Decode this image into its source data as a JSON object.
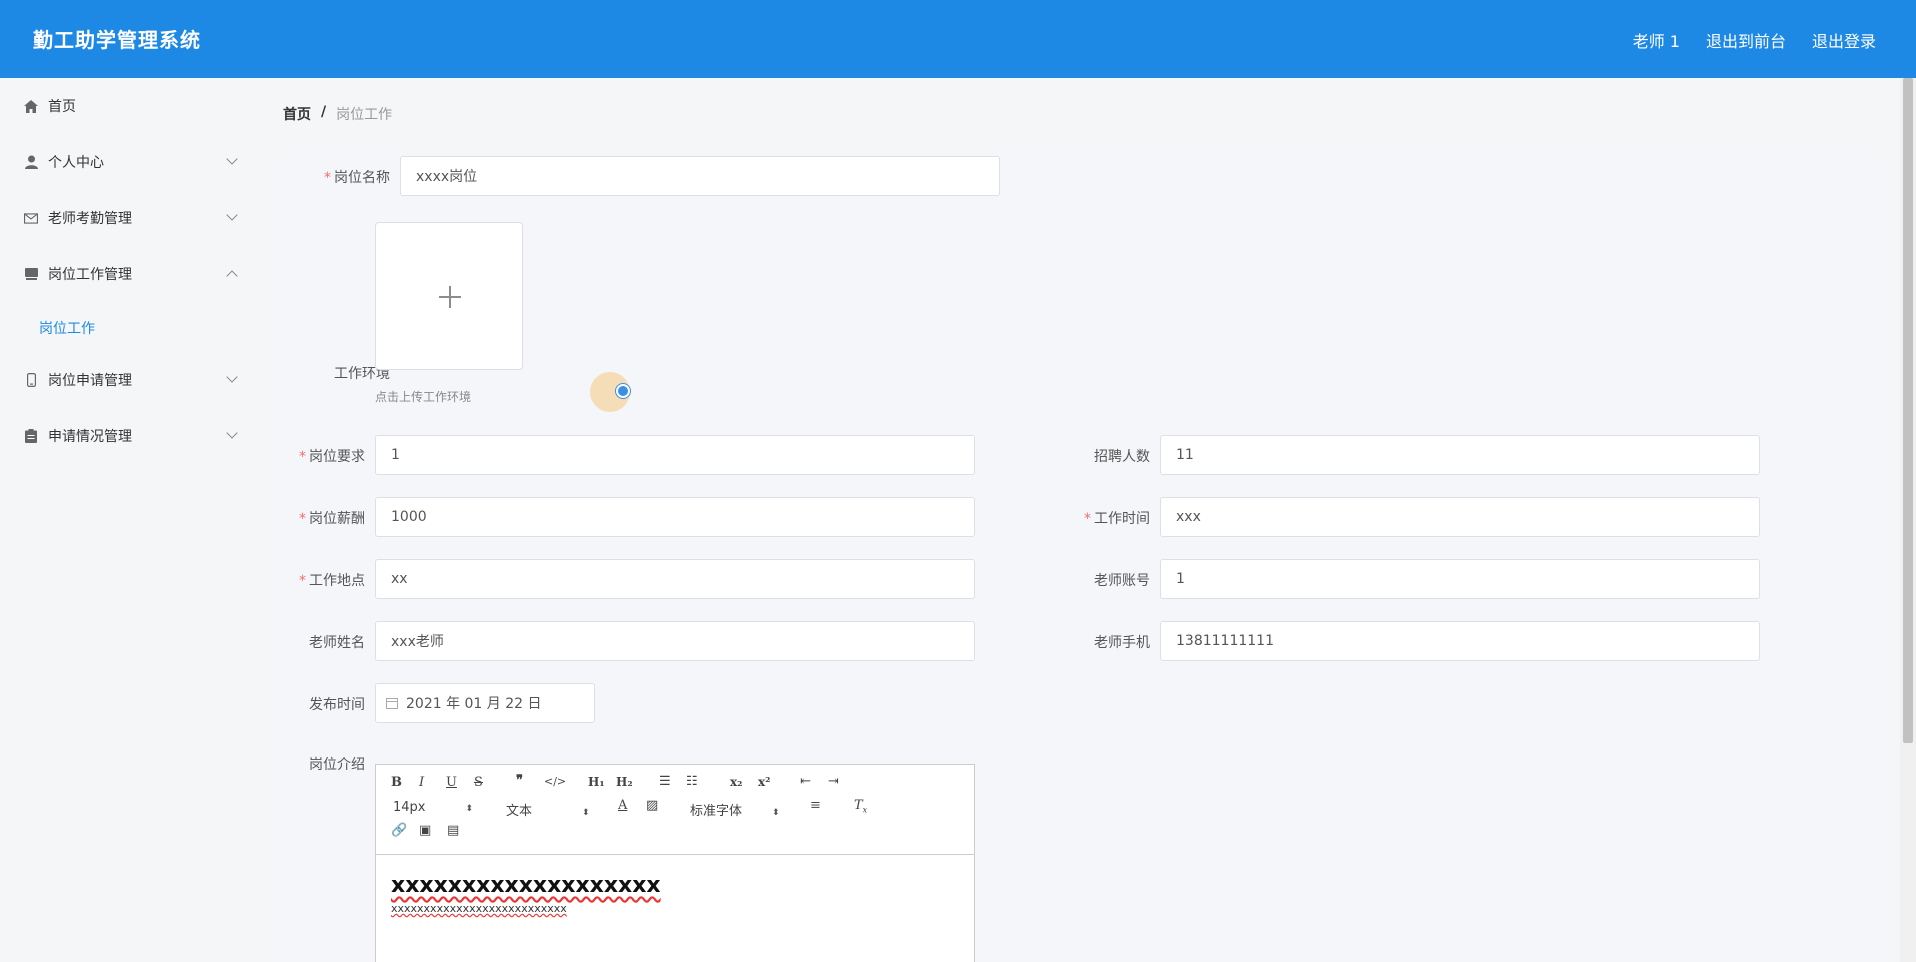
{
  "header": {
    "title": "勤工助学管理系统",
    "user": "老师 1",
    "to_front": "退出到前台",
    "logout": "退出登录"
  },
  "sidebar": {
    "items": [
      {
        "label": "首页",
        "icon": "home-icon"
      },
      {
        "label": "个人中心",
        "icon": "user-icon"
      },
      {
        "label": "老师考勤管理",
        "icon": "mail-icon"
      },
      {
        "label": "岗位工作管理",
        "icon": "stack-icon"
      },
      {
        "label": "岗位申请管理",
        "icon": "phone-icon"
      },
      {
        "label": "申请情况管理",
        "icon": "clipboard-icon"
      }
    ],
    "sub_active": "岗位工作"
  },
  "breadcrumb": {
    "home": "首页",
    "sep": "/",
    "current": "岗位工作"
  },
  "form": {
    "name_label": "岗位名称",
    "name_value": "xxxx岗位",
    "env_label": "工作环境",
    "upload_hint": "点击上传工作环境",
    "req_label": "岗位要求",
    "req_value": "1",
    "count_label": "招聘人数",
    "count_value": "11",
    "salary_label": "岗位薪酬",
    "salary_value": "1000",
    "time_label": "工作时间",
    "time_value": "xxx",
    "place_label": "工作地点",
    "place_value": "xx",
    "account_label": "老师账号",
    "account_value": "1",
    "tname_label": "老师姓名",
    "tname_value": "xxx老师",
    "phone_label": "老师手机",
    "phone_value": "13811111111",
    "pub_label": "发布时间",
    "pub_value": "2021 年 01 月 22 日",
    "intro_label": "岗位介绍"
  },
  "editor": {
    "font_size": "14px",
    "block": "文本",
    "font": "标准字体",
    "heading_text": "xxxxxxxxxxxxxxxxxxx",
    "body_text": "xxxxxxxxxxxxxxxxxxxxxxxxxxx"
  },
  "colors": {
    "accent": "#1e88e5",
    "required": "#f56c6c"
  }
}
